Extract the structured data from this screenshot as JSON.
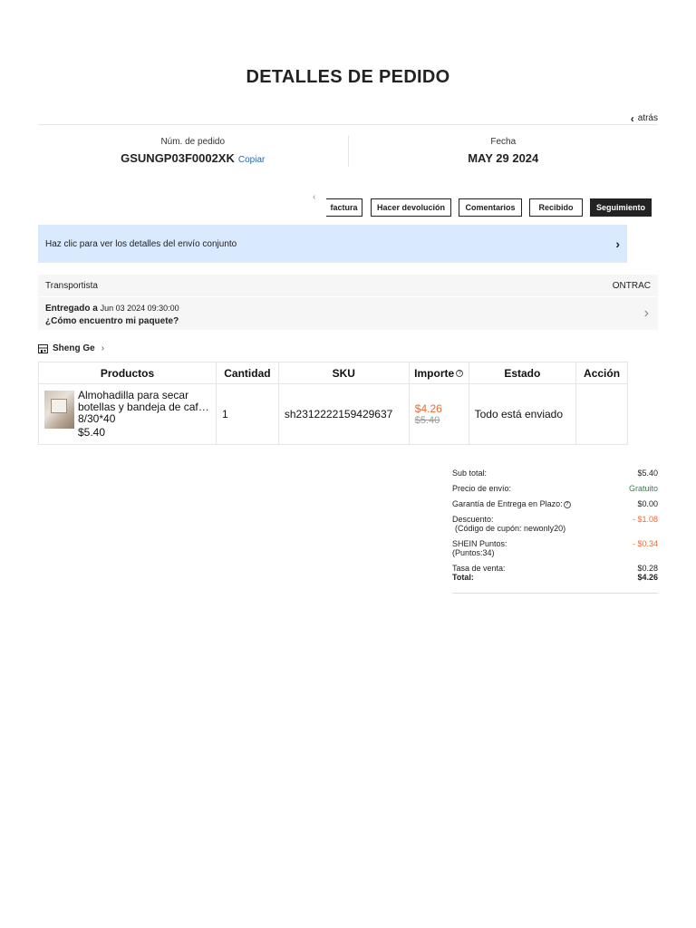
{
  "page": {
    "title": "DETALLES DE PEDIDO",
    "back_label": "atrás"
  },
  "order": {
    "number_label": "Núm. de pedido",
    "number": "GSUNGP03F0002XK",
    "copy_label": "Copiar",
    "date_label": "Fecha",
    "date": "MAY 29 2024"
  },
  "actions": {
    "invoice": "factura",
    "return": "Hacer devolución",
    "comments": "Comentarios",
    "received": "Recibido",
    "tracking": "Seguimiento"
  },
  "banner": {
    "text": "Haz clic para ver los detalles del envío conjunto"
  },
  "shipping": {
    "carrier_label": "Transportista",
    "carrier": "ONTRAC",
    "status": "Entregado a",
    "delivered_at": "Jun 03 2024 09:30:00",
    "help": "¿Cómo encuentro mi paquete?"
  },
  "store": {
    "name": "Sheng Ge"
  },
  "table": {
    "headers": [
      "Productos",
      "Cantidad",
      "SKU",
      "Importe",
      "Estado",
      "Acción"
    ],
    "rows": [
      {
        "name": "Almohadilla para secar botellas y bandeja de caf…",
        "variant": "8/30*40",
        "unit_price": "$5.40",
        "quantity": "1",
        "sku": "sh2312222159429637",
        "price_now": "$4.26",
        "price_old": "$5.40",
        "status": "Todo está enviado",
        "action": ""
      }
    ]
  },
  "summary": {
    "subtotal_label": "Sub total:",
    "subtotal": "$5.40",
    "shipping_label": "Precio de envío:",
    "shipping": "Gratuito",
    "guarantee_label": "Garantía de Entrega en Plazo:",
    "guarantee": "$0.00",
    "discount_label": "Descuento:",
    "discount_sub": "(Código de cupón: newonly20)",
    "discount": "- $1.08",
    "points_label": "SHEIN Puntos:",
    "points_sub": "(Puntos:34)",
    "points": "- $0.34",
    "tax_label": "Tasa de venta:",
    "tax": "$0.28",
    "total_label": "Total:",
    "total": "$4.26"
  },
  "colors": {
    "accent_orange": "#ef6a30",
    "banner_blue": "#d9e9fe",
    "link_blue": "#2d68a8",
    "free_green": "#2b8a3e"
  }
}
